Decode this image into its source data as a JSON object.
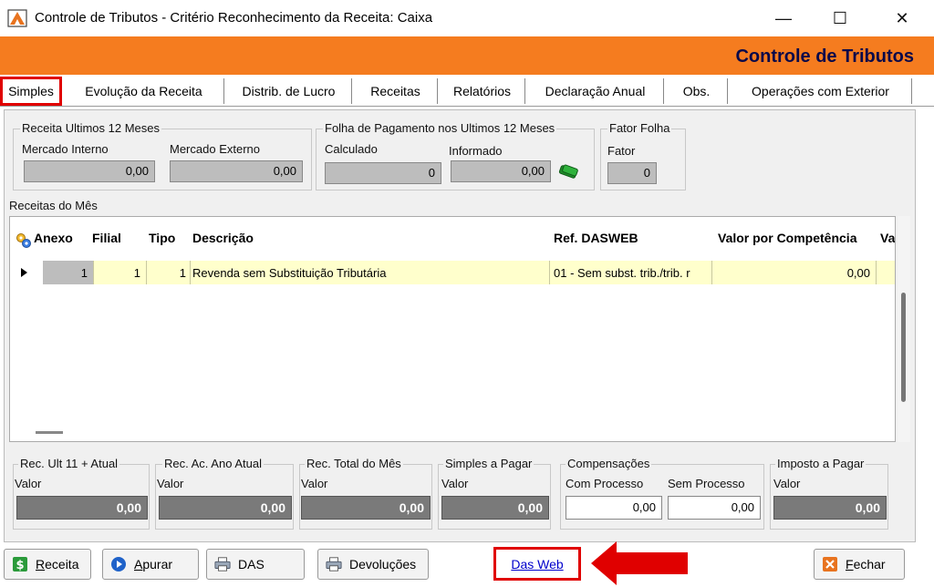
{
  "window": {
    "title": "Controle de Tributos - Critério Reconhecimento da Receita:  Caixa",
    "minimize": "—",
    "maximize": "☐",
    "close": "✕"
  },
  "banner": {
    "title": "Controle de Tributos"
  },
  "tabs": [
    {
      "label": "Simples"
    },
    {
      "label": "Evolução da Receita"
    },
    {
      "label": "Distrib. de Lucro"
    },
    {
      "label": "Receitas"
    },
    {
      "label": "Relatórios"
    },
    {
      "label": "Declaração Anual"
    },
    {
      "label": "Obs."
    },
    {
      "label": "Operações com Exterior"
    }
  ],
  "receita12": {
    "title": "Receita Ultimos 12 Meses",
    "mi_label": "Mercado Interno",
    "mi_value": "0,00",
    "me_label": "Mercado Externo",
    "me_value": "0,00"
  },
  "folha": {
    "title": "Folha de Pagamento nos Ultimos 12 Meses",
    "calc_label": "Calculado",
    "calc_value": "0",
    "inf_label": "Informado",
    "inf_value": "0,00"
  },
  "fator": {
    "title": "Fator Folha",
    "label": "Fator",
    "value": "0"
  },
  "receitas_mes": {
    "title": "Receitas do Mês",
    "columns": [
      "Anexo",
      "Filial",
      "Tipo",
      "Descrição",
      "Ref. DASWEB",
      "Valor por Competência",
      "Va"
    ],
    "rows": [
      {
        "anexo": "1",
        "filial": "1",
        "tipo": "1",
        "descricao": "Revenda sem Substituição Tributária",
        "ref": "01 - Sem subst. trib./trib. r",
        "valor": "0,00"
      }
    ]
  },
  "totais": {
    "rec_ult": {
      "title": "Rec. Ult 11 + Atual",
      "label": "Valor",
      "value": "0,00"
    },
    "rec_ac": {
      "title": "Rec. Ac. Ano Atual",
      "label": "Valor",
      "value": "0,00"
    },
    "rec_total": {
      "title": "Rec. Total do Mês",
      "label": "Valor",
      "value": "0,00"
    },
    "simples": {
      "title": "Simples a Pagar",
      "label": "Valor",
      "value": "0,00"
    },
    "compensacoes": {
      "title": "Compensações",
      "com_label": "Com Processo",
      "com_value": "0,00",
      "sem_label": "Sem Processo",
      "sem_value": "0,00"
    },
    "imposto": {
      "title": "Imposto a Pagar",
      "label": "Valor",
      "value": "0,00"
    }
  },
  "buttons": {
    "receita_first": "R",
    "receita_rest": "eceita",
    "apurar_first": "A",
    "apurar_rest": "purar",
    "das": "DAS",
    "devolucoes": "Devoluções",
    "dasweb": "Das Web",
    "fechar_first": "F",
    "fechar_rest": "echar"
  },
  "colors": {
    "banner": "#f57c1f",
    "highlight": "#e00000",
    "row": "#ffffcc"
  }
}
